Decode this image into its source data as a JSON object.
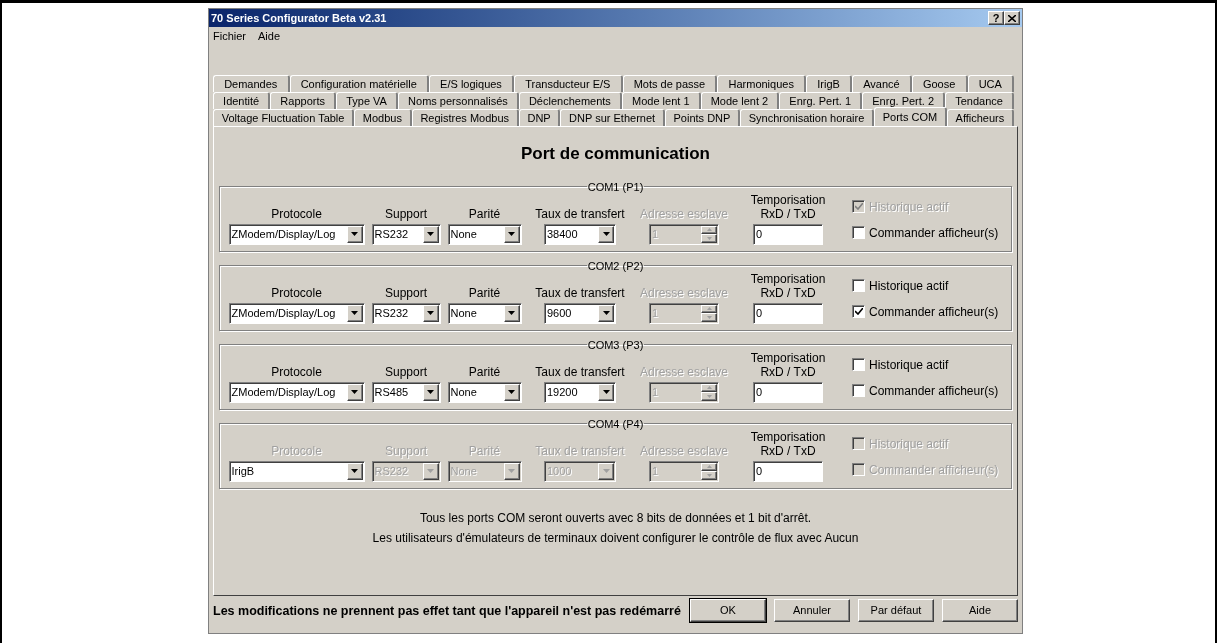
{
  "window": {
    "title": "70 Series Configurator Beta v2.31",
    "help_button": "?"
  },
  "menu": [
    "Fichier",
    "Aide"
  ],
  "tab_rows": [
    [
      {
        "label": "Demandes",
        "selected": false
      },
      {
        "label": "Configuration matérielle",
        "selected": false
      },
      {
        "label": "E/S logiques",
        "selected": false
      },
      {
        "label": "Transducteur E/S",
        "selected": false
      },
      {
        "label": "Mots de passe",
        "selected": false
      },
      {
        "label": "Harmoniques",
        "selected": false
      },
      {
        "label": "IrigB",
        "selected": false
      },
      {
        "label": "Avancé",
        "selected": false
      },
      {
        "label": "Goose",
        "selected": false
      },
      {
        "label": "UCA",
        "selected": false
      }
    ],
    [
      {
        "label": "Identité",
        "selected": false
      },
      {
        "label": "Rapports",
        "selected": false
      },
      {
        "label": "Type VA",
        "selected": false
      },
      {
        "label": "Noms personnalisés",
        "selected": false
      },
      {
        "label": "Déclenchements",
        "selected": false
      },
      {
        "label": "Mode lent 1",
        "selected": false
      },
      {
        "label": "Mode lent 2",
        "selected": false
      },
      {
        "label": "Enrg. Pert. 1",
        "selected": false
      },
      {
        "label": "Enrg. Pert. 2",
        "selected": false
      },
      {
        "label": "Tendance",
        "selected": false
      }
    ],
    [
      {
        "label": "Voltage Fluctuation Table",
        "selected": false
      },
      {
        "label": "Modbus",
        "selected": false
      },
      {
        "label": "Registres Modbus",
        "selected": false
      },
      {
        "label": "DNP",
        "selected": false
      },
      {
        "label": "DNP sur Ethernet",
        "selected": false
      },
      {
        "label": "Points DNP",
        "selected": false
      },
      {
        "label": "Synchronisation horaire",
        "selected": false
      },
      {
        "label": "Ports COM",
        "selected": true
      },
      {
        "label": "Afficheurs",
        "selected": false
      }
    ]
  ],
  "heading": "Port de communication",
  "ports": [
    {
      "title": "COM1 (P1)",
      "fields": [
        {
          "kind": "dropdown",
          "label": "Protocole",
          "label_disabled": false,
          "value": "ZModem/Display/Log",
          "disabled": false
        },
        {
          "kind": "dropdown",
          "label": "Support",
          "label_disabled": false,
          "value": "RS232",
          "disabled": false
        },
        {
          "kind": "dropdown",
          "label": "Parité",
          "label_disabled": false,
          "value": "None",
          "disabled": false
        },
        {
          "kind": "dropdown",
          "label": "Taux de transfert",
          "label_disabled": false,
          "value": "38400",
          "disabled": false
        },
        {
          "kind": "spinner",
          "label": "Adresse esclave",
          "label_disabled": true,
          "value": "1",
          "disabled": true
        },
        {
          "kind": "text",
          "label": "Temporisation RxD / TxD",
          "label_disabled": false,
          "value": "0",
          "disabled": false
        }
      ],
      "checkboxes": [
        {
          "label": "Historique actif",
          "checked": true,
          "disabled": true
        },
        {
          "label": "Commander afficheur(s)",
          "checked": false,
          "disabled": false
        }
      ]
    },
    {
      "title": "COM2 (P2)",
      "fields": [
        {
          "kind": "dropdown",
          "label": "Protocole",
          "label_disabled": false,
          "value": "ZModem/Display/Log",
          "disabled": false
        },
        {
          "kind": "dropdown",
          "label": "Support",
          "label_disabled": false,
          "value": "RS232",
          "disabled": false
        },
        {
          "kind": "dropdown",
          "label": "Parité",
          "label_disabled": false,
          "value": "None",
          "disabled": false
        },
        {
          "kind": "dropdown",
          "label": "Taux de transfert",
          "label_disabled": false,
          "value": "9600",
          "disabled": false
        },
        {
          "kind": "spinner",
          "label": "Adresse esclave",
          "label_disabled": true,
          "value": "1",
          "disabled": true
        },
        {
          "kind": "text",
          "label": "Temporisation RxD / TxD",
          "label_disabled": false,
          "value": "0",
          "disabled": false
        }
      ],
      "checkboxes": [
        {
          "label": "Historique actif",
          "checked": false,
          "disabled": false
        },
        {
          "label": "Commander afficheur(s)",
          "checked": true,
          "disabled": false
        }
      ]
    },
    {
      "title": "COM3 (P3)",
      "fields": [
        {
          "kind": "dropdown",
          "label": "Protocole",
          "label_disabled": false,
          "value": "ZModem/Display/Log",
          "disabled": false
        },
        {
          "kind": "dropdown",
          "label": "Support",
          "label_disabled": false,
          "value": "RS485",
          "disabled": false
        },
        {
          "kind": "dropdown",
          "label": "Parité",
          "label_disabled": false,
          "value": "None",
          "disabled": false
        },
        {
          "kind": "dropdown",
          "label": "Taux de transfert",
          "label_disabled": false,
          "value": "19200",
          "disabled": false
        },
        {
          "kind": "spinner",
          "label": "Adresse esclave",
          "label_disabled": true,
          "value": "1",
          "disabled": true
        },
        {
          "kind": "text",
          "label": "Temporisation RxD / TxD",
          "label_disabled": false,
          "value": "0",
          "disabled": false
        }
      ],
      "checkboxes": [
        {
          "label": "Historique actif",
          "checked": false,
          "disabled": false
        },
        {
          "label": "Commander afficheur(s)",
          "checked": false,
          "disabled": false
        }
      ]
    },
    {
      "title": "COM4 (P4)",
      "fields": [
        {
          "kind": "dropdown",
          "label": "Protocole",
          "label_disabled": true,
          "value": "IrigB",
          "disabled": false
        },
        {
          "kind": "dropdown",
          "label": "Support",
          "label_disabled": true,
          "value": "RS232",
          "disabled": true
        },
        {
          "kind": "dropdown",
          "label": "Parité",
          "label_disabled": true,
          "value": "None",
          "disabled": true
        },
        {
          "kind": "dropdown",
          "label": "Taux de transfert",
          "label_disabled": true,
          "value": "1000",
          "disabled": true
        },
        {
          "kind": "spinner",
          "label": "Adresse esclave",
          "label_disabled": true,
          "value": "1",
          "disabled": true
        },
        {
          "kind": "text",
          "label": "Temporisation RxD / TxD",
          "label_disabled": false,
          "value": "0",
          "disabled": false
        }
      ],
      "checkboxes": [
        {
          "label": "Historique actif",
          "checked": false,
          "disabled": true
        },
        {
          "label": "Commander afficheur(s)",
          "checked": false,
          "disabled": true
        }
      ]
    }
  ],
  "notes": [
    "Tous les ports COM seront ouverts avec 8 bits de données et 1 bit d'arrêt.",
    "Les utilisateurs d'émulateurs de terminaux doivent configurer le contrôle de flux avec Aucun"
  ],
  "status": "Les modifications ne prennent pas effet tant que l'appareil n'est pas redémarré",
  "buttons": [
    {
      "label": "OK",
      "default": true
    },
    {
      "label": "Annuler",
      "default": false
    },
    {
      "label": "Par défaut",
      "default": false
    },
    {
      "label": "Aide",
      "default": false
    }
  ]
}
